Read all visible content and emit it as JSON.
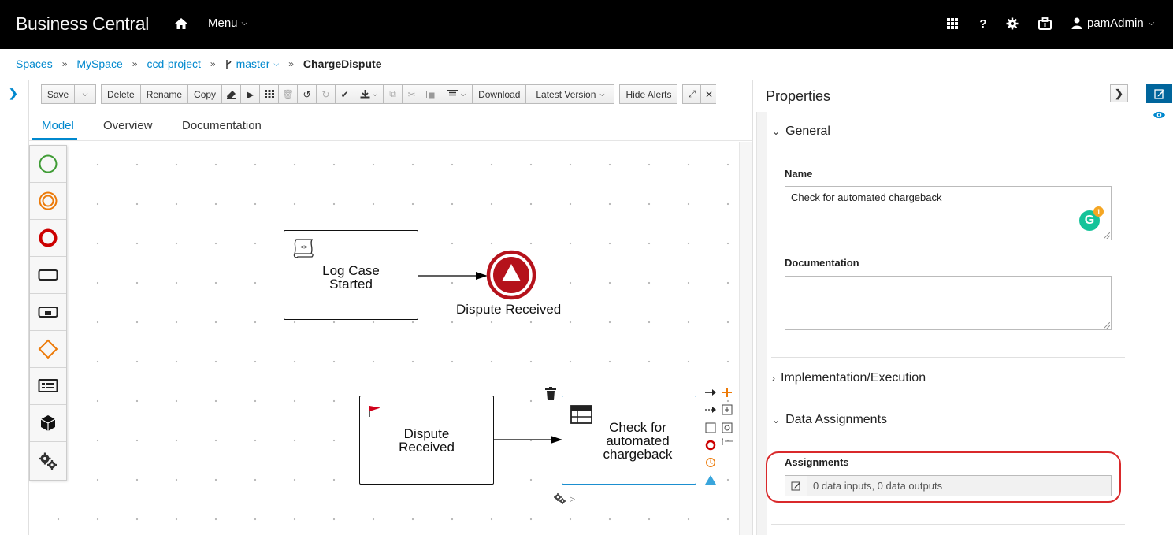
{
  "app": {
    "title": "Business Central",
    "menu_label": "Menu",
    "user": "pamAdmin"
  },
  "breadcrumb": {
    "items": [
      "Spaces",
      "MySpace",
      "ccd-project"
    ],
    "branch": "master",
    "current": "ChargeDispute"
  },
  "toolbar": {
    "save": "Save",
    "delete": "Delete",
    "rename": "Rename",
    "copy": "Copy",
    "download": "Download",
    "latest_version": "Latest Version",
    "hide_alerts": "Hide Alerts"
  },
  "tabs": {
    "model": "Model",
    "overview": "Overview",
    "documentation": "Documentation"
  },
  "palette": [
    "start-event-icon",
    "intermediate-event-icon",
    "end-event-icon",
    "task-icon",
    "subprocess-icon",
    "gateway-icon",
    "lane-icon",
    "custom-task-icon",
    "service-tasks-icon"
  ],
  "diagram": {
    "task1": {
      "line1": "Log Case",
      "line2": "Started"
    },
    "end_event_label": "Dispute Received",
    "task2": {
      "line1": "Dispute",
      "line2": "Received"
    },
    "task3": {
      "line1": "Check for",
      "line2": "automated",
      "line3": "chargeback"
    }
  },
  "properties": {
    "title": "Properties",
    "sections": {
      "general": "General",
      "implementation": "Implementation/Execution",
      "data_assignments": "Data Assignments"
    },
    "name_label": "Name",
    "name_value": "Check for automated chargeback",
    "documentation_label": "Documentation",
    "documentation_value": "",
    "assignments_label": "Assignments",
    "assignments_value": "0 data inputs, 0 data outputs",
    "grammarly_badge": "1"
  },
  "colors": {
    "accent": "#0088ce",
    "highlight": "#d9292b",
    "end_event": "#b5121b"
  }
}
